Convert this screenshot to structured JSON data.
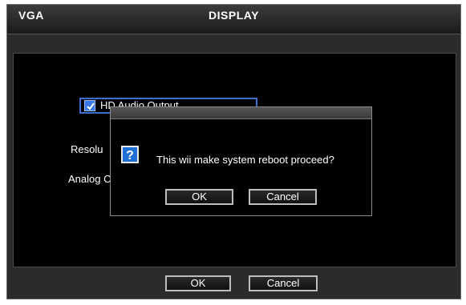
{
  "window": {
    "left_title": "VGA",
    "title": "DISPLAY"
  },
  "settings": {
    "hd_audio_label": "HD Audio Output",
    "hd_audio_checked": true,
    "resolution_label": "Resolu",
    "analog_label": "Analog C"
  },
  "footer": {
    "ok_label": "OK",
    "cancel_label": "Cancel"
  },
  "dialog": {
    "icon": "question-icon",
    "message": "This wii make system reboot proceed?",
    "ok_label": "OK",
    "cancel_label": "Cancel"
  },
  "colors": {
    "accent": "#3b78e7",
    "background": "#000000",
    "frame": "#2b2b2b"
  }
}
